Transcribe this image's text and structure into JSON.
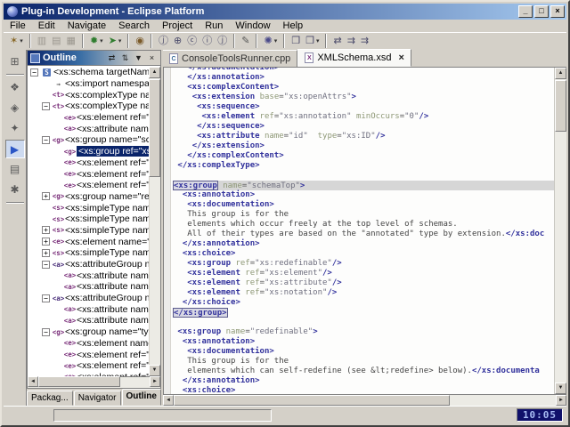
{
  "colors": {
    "titlebar_left": "#0a246a",
    "titlebar_right": "#a6caf0",
    "chrome": "#d4d0c8",
    "selection": "#0a246a",
    "clock_bg": "#10106a",
    "clock_fg": "#a9bdf5",
    "syntax_tag": "#31319c",
    "syntax_attr": "#8e9876",
    "syntax_value": "#6f6f7f",
    "syntax_text": "#454545"
  },
  "titlebar": {
    "title": "Plug-in Development - Eclipse Platform",
    "minimize": "_",
    "restore": "□",
    "close": "×"
  },
  "menubar": {
    "items": [
      "File",
      "Edit",
      "Navigate",
      "Search",
      "Project",
      "Run",
      "Window",
      "Help"
    ]
  },
  "toolbar": {
    "groups": [
      [
        {
          "name": "new-wizard-button",
          "glyph": "✶",
          "dropdown": true,
          "color": "#8a6a2a"
        }
      ],
      [
        {
          "name": "save-button",
          "glyph": "▥",
          "disabled": true
        },
        {
          "name": "save-as-button",
          "glyph": "▤",
          "disabled": true
        },
        {
          "name": "print-button",
          "glyph": "▦",
          "disabled": true
        }
      ],
      [
        {
          "name": "debug-button",
          "glyph": "✹",
          "dropdown": true,
          "color": "#2f7d2f"
        },
        {
          "name": "run-button",
          "glyph": "➤",
          "dropdown": true,
          "color": "#2f7d2f"
        }
      ],
      [
        {
          "name": "console-button",
          "glyph": "◉",
          "color": "#7a5a2a"
        }
      ],
      [
        {
          "name": "new-java-project-button",
          "glyph": "ⓙ"
        },
        {
          "name": "new-package-button",
          "glyph": "⊕"
        },
        {
          "name": "new-class-button",
          "glyph": "ⓒ"
        },
        {
          "name": "new-interface-button",
          "glyph": "ⓘ"
        },
        {
          "name": "new-junit-test-button",
          "glyph": "ⓙ"
        }
      ],
      [
        {
          "name": "pencil-button",
          "glyph": "✎",
          "color": "#555"
        }
      ],
      [
        {
          "name": "search-button",
          "glyph": "✺",
          "dropdown": true,
          "color": "#4a4a8a"
        }
      ],
      [
        {
          "name": "open-type-button",
          "glyph": "❒"
        },
        {
          "name": "open-resource-button",
          "glyph": "❒",
          "dropdown": true
        }
      ],
      [
        {
          "name": "last-edit-location-button",
          "glyph": "⇄"
        },
        {
          "name": "back-button",
          "glyph": "⇉"
        },
        {
          "name": "forward-button",
          "glyph": "⇉"
        }
      ]
    ],
    "dropdown_glyph": "▾"
  },
  "perspective_bar": {
    "items": [
      {
        "name": "open-perspective-button",
        "glyph": "⊞"
      },
      {
        "sep": true
      },
      {
        "name": "resource-perspective-button",
        "glyph": "❖"
      },
      {
        "name": "java-perspective-button",
        "glyph": "◈"
      },
      {
        "name": "plugin-perspective-button",
        "glyph": "✦"
      },
      {
        "name": "debug-perspective-button",
        "glyph": "▶",
        "active": true
      },
      {
        "name": "team-perspective-button",
        "glyph": "▤"
      },
      {
        "name": "xml-perspective-button",
        "glyph": "✱"
      },
      {
        "sep": true
      }
    ]
  },
  "outline": {
    "title": "Outline",
    "toolbar": [
      {
        "name": "link-with-editor-button",
        "glyph": "⇄"
      },
      {
        "name": "sort-button",
        "glyph": "⇅"
      },
      {
        "name": "view-menu-button",
        "glyph": "▼"
      },
      {
        "name": "close-view-button",
        "glyph": "×"
      }
    ],
    "icons": {
      "schema": {
        "glyph": "S",
        "color": "#ffffff",
        "bg": "#5577bb"
      },
      "import": {
        "glyph": "→",
        "color": "#555555"
      },
      "complexType": {
        "glyph": "<t>",
        "color": "#7a2f7a"
      },
      "element": {
        "glyph": "<e>",
        "color": "#7a2f7a"
      },
      "attribute": {
        "glyph": "<a>",
        "color": "#7a2f7a"
      },
      "group": {
        "glyph": "<g>",
        "color": "#7a2f7a"
      },
      "simpleType": {
        "glyph": "<s>",
        "color": "#7a2f7a"
      },
      "attributeGroup": {
        "glyph": "<a>",
        "color": "#4a2f7a"
      }
    },
    "items": [
      {
        "icon": "schema",
        "exp": "minus",
        "lvl": 0,
        "label": "<xs:schema targetNamesp"
      },
      {
        "icon": "import",
        "lvl": 1,
        "label": "<xs:import namespace="
      },
      {
        "icon": "complexType",
        "lvl": 1,
        "label": "<xs:complexType name"
      },
      {
        "icon": "complexType",
        "exp": "minus",
        "lvl": 1,
        "label": "<xs:complexType name"
      },
      {
        "icon": "element",
        "lvl": 2,
        "label": "<xs:element ref=\"x"
      },
      {
        "icon": "attribute",
        "lvl": 2,
        "label": "<xs:attribute name"
      },
      {
        "icon": "group",
        "exp": "minus",
        "lvl": 1,
        "label": "<xs:group name=\"sche"
      },
      {
        "icon": "group",
        "lvl": 2,
        "label": "<xs:group ref=\"xs:",
        "selected": true
      },
      {
        "icon": "element",
        "lvl": 2,
        "label": "<xs:element ref=\"x"
      },
      {
        "icon": "element",
        "lvl": 2,
        "label": "<xs:element ref=\"x"
      },
      {
        "icon": "element",
        "lvl": 2,
        "label": "<xs:element ref=\"x"
      },
      {
        "icon": "group",
        "exp": "plus",
        "lvl": 1,
        "label": "<xs:group name=\"rede"
      },
      {
        "icon": "simpleType",
        "lvl": 1,
        "label": "<xs:simpleType name="
      },
      {
        "icon": "simpleType",
        "lvl": 1,
        "label": "<xs:simpleType name="
      },
      {
        "icon": "simpleType",
        "exp": "plus",
        "lvl": 1,
        "label": "<xs:simpleType name="
      },
      {
        "icon": "element",
        "exp": "plus",
        "lvl": 1,
        "label": "<xs:element name=\"sc"
      },
      {
        "icon": "simpleType",
        "exp": "plus",
        "lvl": 1,
        "label": "<xs:simpleType name="
      },
      {
        "icon": "attributeGroup",
        "exp": "minus",
        "lvl": 1,
        "label": "<xs:attributeGroup nam"
      },
      {
        "icon": "attribute",
        "lvl": 2,
        "label": "<xs:attribute name"
      },
      {
        "icon": "attribute",
        "lvl": 2,
        "label": "<xs:attribute name"
      },
      {
        "icon": "attributeGroup",
        "exp": "minus",
        "lvl": 1,
        "label": "<xs:attributeGroup nam"
      },
      {
        "icon": "attribute",
        "lvl": 2,
        "label": "<xs:attribute name"
      },
      {
        "icon": "attribute",
        "lvl": 2,
        "label": "<xs:attribute name"
      },
      {
        "icon": "group",
        "exp": "minus",
        "lvl": 1,
        "label": "<xs:group name=\"type"
      },
      {
        "icon": "element",
        "lvl": 2,
        "label": "<xs:element name="
      },
      {
        "icon": "element",
        "lvl": 2,
        "label": "<xs:element ref=\"x"
      },
      {
        "icon": "element",
        "lvl": 2,
        "label": "<xs:element ref=\"x"
      },
      {
        "icon": "element",
        "lvl": 2,
        "label": "<xs:element ref=\"x"
      }
    ]
  },
  "editor": {
    "tabs": [
      {
        "label": "ConsoleToolsRunner.cpp",
        "icon": "C",
        "icon_color": "#3a6a9a",
        "active": false
      },
      {
        "label": "XMLSchema.xsd",
        "icon": "X",
        "icon_color": "#7a2f7a",
        "active": true,
        "close": "×"
      }
    ],
    "lines": [
      {
        "t": [
          [
            "sp",
            "   "
          ],
          [
            "tag",
            "</xs:documentation>"
          ]
        ]
      },
      {
        "t": [
          [
            "sp",
            "   "
          ],
          [
            "tag",
            "</xs:annotation>"
          ]
        ]
      },
      {
        "t": [
          [
            "sp",
            "   "
          ],
          [
            "tag",
            "<xs:complexContent>"
          ]
        ]
      },
      {
        "t": [
          [
            "sp",
            "    "
          ],
          [
            "tag",
            "<xs:extension"
          ],
          [
            "sp",
            " "
          ],
          [
            "attr",
            "base"
          ],
          [
            "eq",
            "="
          ],
          [
            "val",
            "\"xs:openAttrs\""
          ],
          [
            "tag",
            ">"
          ]
        ]
      },
      {
        "t": [
          [
            "sp",
            "     "
          ],
          [
            "tag",
            "<xs:sequence>"
          ]
        ]
      },
      {
        "t": [
          [
            "sp",
            "      "
          ],
          [
            "tag",
            "<xs:element"
          ],
          [
            "sp",
            " "
          ],
          [
            "attr",
            "ref"
          ],
          [
            "eq",
            "="
          ],
          [
            "val",
            "\"xs:annotation\""
          ],
          [
            "sp",
            " "
          ],
          [
            "attr",
            "minOccurs"
          ],
          [
            "eq",
            "="
          ],
          [
            "val",
            "\"0\""
          ],
          [
            "tag",
            "/>"
          ]
        ]
      },
      {
        "t": [
          [
            "sp",
            "     "
          ],
          [
            "tag",
            "</xs:sequence>"
          ]
        ]
      },
      {
        "t": [
          [
            "sp",
            "     "
          ],
          [
            "tag",
            "<xs:attribute"
          ],
          [
            "sp",
            " "
          ],
          [
            "attr",
            "name"
          ],
          [
            "eq",
            "="
          ],
          [
            "val",
            "\"id\""
          ],
          [
            "sp",
            "  "
          ],
          [
            "attr",
            "type"
          ],
          [
            "eq",
            "="
          ],
          [
            "val",
            "\"xs:ID\""
          ],
          [
            "tag",
            "/>"
          ]
        ]
      },
      {
        "t": [
          [
            "sp",
            "    "
          ],
          [
            "tag",
            "</xs:extension>"
          ]
        ]
      },
      {
        "t": [
          [
            "sp",
            "   "
          ],
          [
            "tag",
            "</xs:complexContent>"
          ]
        ]
      },
      {
        "t": [
          [
            "sp",
            " "
          ],
          [
            "tag",
            "</xs:complexType>"
          ]
        ]
      },
      {
        "t": []
      },
      {
        "hl": true,
        "t": [
          [
            "tagbox",
            "<xs:group"
          ],
          [
            "sp",
            " "
          ],
          [
            "attr",
            "name"
          ],
          [
            "eq",
            "="
          ],
          [
            "val",
            "\"schemaTop\""
          ],
          [
            "tag",
            ">"
          ]
        ]
      },
      {
        "t": [
          [
            "sp",
            "  "
          ],
          [
            "tag",
            "<xs:annotation>"
          ]
        ]
      },
      {
        "t": [
          [
            "sp",
            "   "
          ],
          [
            "tag",
            "<xs:documentation>"
          ]
        ]
      },
      {
        "t": [
          [
            "sp",
            "   "
          ],
          [
            "text",
            "This group is for the"
          ]
        ]
      },
      {
        "t": [
          [
            "sp",
            "   "
          ],
          [
            "text",
            "elements which occur freely at the top level of schemas."
          ]
        ]
      },
      {
        "t": [
          [
            "sp",
            "   "
          ],
          [
            "text",
            "All of their types are based on the \"annotated\" type by extension."
          ],
          [
            "tag",
            "</xs:doc"
          ]
        ]
      },
      {
        "t": [
          [
            "sp",
            "  "
          ],
          [
            "tag",
            "</xs:annotation>"
          ]
        ]
      },
      {
        "t": [
          [
            "sp",
            "  "
          ],
          [
            "tag",
            "<xs:choice>"
          ]
        ]
      },
      {
        "t": [
          [
            "sp",
            "   "
          ],
          [
            "tag",
            "<xs:group"
          ],
          [
            "sp",
            " "
          ],
          [
            "attr",
            "ref"
          ],
          [
            "eq",
            "="
          ],
          [
            "val",
            "\"xs:redefinable\""
          ],
          [
            "tag",
            "/>"
          ]
        ]
      },
      {
        "t": [
          [
            "sp",
            "   "
          ],
          [
            "tag",
            "<xs:element"
          ],
          [
            "sp",
            " "
          ],
          [
            "attr",
            "ref"
          ],
          [
            "eq",
            "="
          ],
          [
            "val",
            "\"xs:element\""
          ],
          [
            "tag",
            "/>"
          ]
        ]
      },
      {
        "t": [
          [
            "sp",
            "   "
          ],
          [
            "tag",
            "<xs:element"
          ],
          [
            "sp",
            " "
          ],
          [
            "attr",
            "ref"
          ],
          [
            "eq",
            "="
          ],
          [
            "val",
            "\"xs:attribute\""
          ],
          [
            "tag",
            "/>"
          ]
        ]
      },
      {
        "t": [
          [
            "sp",
            "   "
          ],
          [
            "tag",
            "<xs:element"
          ],
          [
            "sp",
            " "
          ],
          [
            "attr",
            "ref"
          ],
          [
            "eq",
            "="
          ],
          [
            "val",
            "\"xs:notation\""
          ],
          [
            "tag",
            "/>"
          ]
        ]
      },
      {
        "t": [
          [
            "sp",
            "  "
          ],
          [
            "tag",
            "</xs:choice>"
          ]
        ]
      },
      {
        "t": [
          [
            "tagbox",
            "</xs:group>"
          ]
        ]
      },
      {
        "t": []
      },
      {
        "t": [
          [
            "sp",
            " "
          ],
          [
            "tag",
            "<xs:group"
          ],
          [
            "sp",
            " "
          ],
          [
            "attr",
            "name"
          ],
          [
            "eq",
            "="
          ],
          [
            "val",
            "\"redefinable\""
          ],
          [
            "tag",
            ">"
          ]
        ]
      },
      {
        "t": [
          [
            "sp",
            "  "
          ],
          [
            "tag",
            "<xs:annotation>"
          ]
        ]
      },
      {
        "t": [
          [
            "sp",
            "   "
          ],
          [
            "tag",
            "<xs:documentation>"
          ]
        ]
      },
      {
        "t": [
          [
            "sp",
            "   "
          ],
          [
            "text",
            "This group is for the"
          ]
        ]
      },
      {
        "t": [
          [
            "sp",
            "   "
          ],
          [
            "text",
            "elements which can self-redefine (see &lt;redefine> below)."
          ],
          [
            "tag",
            "</xs:documenta"
          ]
        ]
      },
      {
        "t": [
          [
            "sp",
            "  "
          ],
          [
            "tag",
            "</xs:annotation>"
          ]
        ]
      },
      {
        "t": [
          [
            "sp",
            "  "
          ],
          [
            "tag",
            "<xs:choice>"
          ]
        ]
      }
    ]
  },
  "view_tabs": {
    "items": [
      {
        "label": "Packag...",
        "active": false
      },
      {
        "label": "Navigator",
        "active": false
      },
      {
        "label": "Outline",
        "active": true
      }
    ],
    "scroll_left": "◄",
    "scroll_right": "►"
  },
  "scroll_glyphs": {
    "up": "▲",
    "down": "▼",
    "left": "◄",
    "right": "►"
  },
  "statusbar": {
    "clock": "10:05"
  }
}
